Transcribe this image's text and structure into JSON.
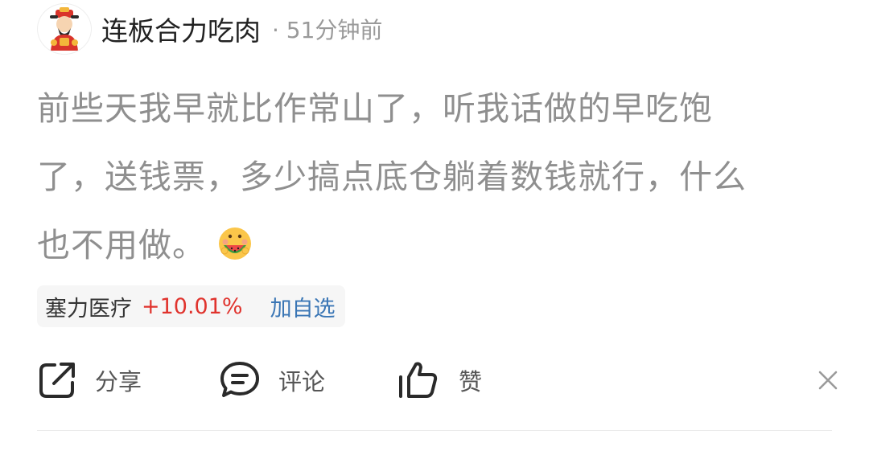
{
  "post": {
    "author": {
      "name": "连板合力吃肉",
      "avatar_icon": "fortune-god-avatar"
    },
    "time": "· 51分钟前",
    "content_lines": [
      "前些天我早就比作常山了，听我话做的早吃饱",
      "了，送钱票，多少搞点底仓躺着数钱就行，什么",
      "也不用做。"
    ],
    "emoji_icon": "watermelon-eating-emoji"
  },
  "stock": {
    "name": "塞力医疗",
    "change": "+10.01%",
    "add_label": "加自选",
    "change_color": "#e0332d",
    "add_color": "#3a76b5"
  },
  "actions": {
    "share_label": "分享",
    "comment_label": "评论",
    "like_label": "赞",
    "close_icon": "close-icon"
  }
}
